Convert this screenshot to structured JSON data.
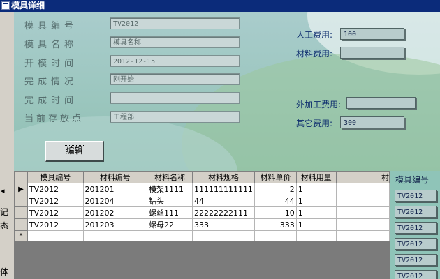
{
  "window": {
    "title": "模具详细"
  },
  "left_strip": {
    "arrow": "◂",
    "chars": [
      "记",
      "态",
      "体"
    ]
  },
  "form": {
    "left_fields": [
      {
        "label": "模具编号",
        "value": "TV2012"
      },
      {
        "label": "模具名称",
        "value": "模具名称"
      },
      {
        "label": "开模时间",
        "value": "2012-12-15"
      },
      {
        "label": "完成情况",
        "value": "刚开始"
      },
      {
        "label": "完成时间",
        "value": ""
      },
      {
        "label": "当前存放点",
        "value": "工程部"
      }
    ],
    "right_fields": [
      {
        "label": "人工费用:",
        "value": "100"
      },
      {
        "label": "材料费用:",
        "value": ""
      },
      {
        "label": "外加工费用:",
        "value": ""
      },
      {
        "label": "其它费用:",
        "value": "300"
      }
    ],
    "edit_button": "编辑"
  },
  "grid": {
    "columns": [
      "模具编号",
      "材料编号",
      "材料名称",
      "材料规格",
      "材料单价",
      "材料用量",
      "村"
    ],
    "rows": [
      [
        "TV2012",
        "201201",
        "模架1111",
        "111111111111",
        "2",
        "1"
      ],
      [
        "TV2012",
        "201204",
        "钻头",
        "44",
        "44",
        "1"
      ],
      [
        "TV2012",
        "201202",
        "螺丝111",
        "22222222111",
        "10",
        "1"
      ],
      [
        "TV2012",
        "201203",
        "螺母22",
        "333",
        "333",
        "1"
      ]
    ],
    "new_row_marker": "*",
    "current_row_marker": "▶"
  },
  "subpanel": {
    "header": "模具编号",
    "values": [
      "TV2012",
      "TV2012",
      "TV2012",
      "TV2012",
      "TV2012",
      "TV2012"
    ]
  }
}
